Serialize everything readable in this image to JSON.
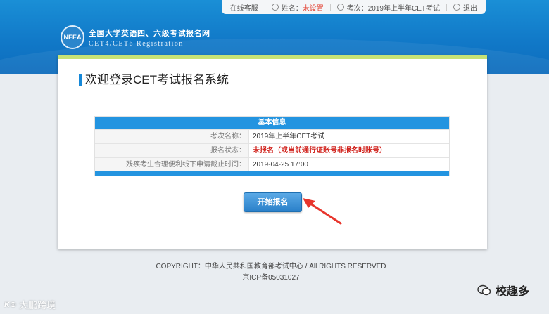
{
  "topbar": {
    "service": "在线客服",
    "name_label": "姓名：",
    "name_value": "未设置",
    "exam_label": "考次：",
    "exam_value": "2019年上半年CET考试",
    "logout": "退出"
  },
  "logo": {
    "emblem_text": "NEEA",
    "title": "全国大学英语四、六级考试报名网",
    "subtitle": "CET4/CET6  Registration"
  },
  "panel": {
    "title": "欢迎登录CET考试报名系统"
  },
  "info": {
    "header": "基本信息",
    "rows": [
      {
        "label": "考次名称：",
        "value": "2019年上半年CET考试"
      },
      {
        "label": "报名状态：",
        "value": "未报名（或当前通行证账号非报名时账号）"
      },
      {
        "label": "残疾考生合理便利线下申请截止时间：",
        "value": "2019-04-25 17:00"
      }
    ]
  },
  "start_button": "开始报名",
  "footer": {
    "copyright": "COPYRIGHT：中华人民共和国教育部考试中心 / All RIGHTS RESERVED",
    "icp": "京ICP备05031027"
  },
  "watermarks": {
    "left_mark": "K⊙",
    "left_text": "大鹏跨境",
    "right_text": "校趣多"
  },
  "colors": {
    "header_blue": "#1179c8",
    "accent_blue": "#2394e0",
    "alert_red": "#d0201a",
    "green_bar": "#c6e276",
    "arrow_red": "#e8352c"
  }
}
